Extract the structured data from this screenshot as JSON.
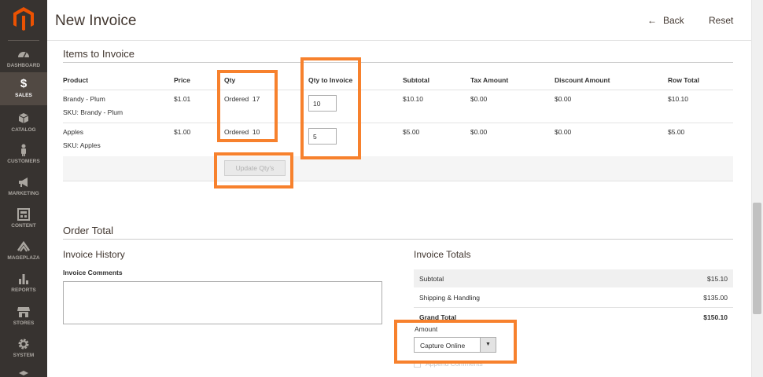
{
  "sidebar": {
    "items": [
      {
        "label": "DASHBOARD",
        "icon": "dashboard-icon"
      },
      {
        "label": "SALES",
        "icon": "dollar-icon"
      },
      {
        "label": "CATALOG",
        "icon": "cube-icon"
      },
      {
        "label": "CUSTOMERS",
        "icon": "person-icon"
      },
      {
        "label": "MARKETING",
        "icon": "megaphone-icon"
      },
      {
        "label": "CONTENT",
        "icon": "layout-icon"
      },
      {
        "label": "MAGEPLAZA",
        "icon": "mageplaza-icon"
      },
      {
        "label": "REPORTS",
        "icon": "bar-chart-icon"
      },
      {
        "label": "STORES",
        "icon": "store-icon"
      },
      {
        "label": "SYSTEM",
        "icon": "gear-icon"
      }
    ],
    "active": "SALES",
    "colors": {
      "bg": "#373330",
      "active_bg": "#514943",
      "logo": "#eb5202"
    }
  },
  "header": {
    "title": "New Invoice",
    "back_label": "Back",
    "reset_label": "Reset"
  },
  "items_section": {
    "title": "Items to Invoice",
    "columns": [
      "Product",
      "Price",
      "Qty",
      "Qty to Invoice",
      "Subtotal",
      "Tax Amount",
      "Discount Amount",
      "Row Total"
    ],
    "rows": [
      {
        "product": "Brandy - Plum",
        "sku": "SKU: Brandy - Plum",
        "price": "$1.01",
        "qty_label": "Ordered",
        "qty": "17",
        "qty_to_invoice": "10",
        "subtotal": "$10.10",
        "tax": "$0.00",
        "discount": "$0.00",
        "row_total": "$10.10"
      },
      {
        "product": "Apples",
        "sku": "SKU: Apples",
        "price": "$1.00",
        "qty_label": "Ordered",
        "qty": "10",
        "qty_to_invoice": "5",
        "subtotal": "$5.00",
        "tax": "$0.00",
        "discount": "$0.00",
        "row_total": "$5.00"
      }
    ],
    "update_button": "Update Qty's"
  },
  "order_total": {
    "title": "Order Total",
    "history_title": "Invoice History",
    "comments_label": "Invoice Comments",
    "totals_title": "Invoice Totals",
    "totals": [
      {
        "label": "Subtotal",
        "value": "$15.10"
      },
      {
        "label": "Shipping & Handling",
        "value": "$135.00"
      },
      {
        "label": "Grand Total",
        "value": "$150.10"
      }
    ],
    "amount_label": "Amount",
    "amount_selected": "Capture Online",
    "append_comments": "Append Comments"
  },
  "highlight_color": "#f7812d"
}
